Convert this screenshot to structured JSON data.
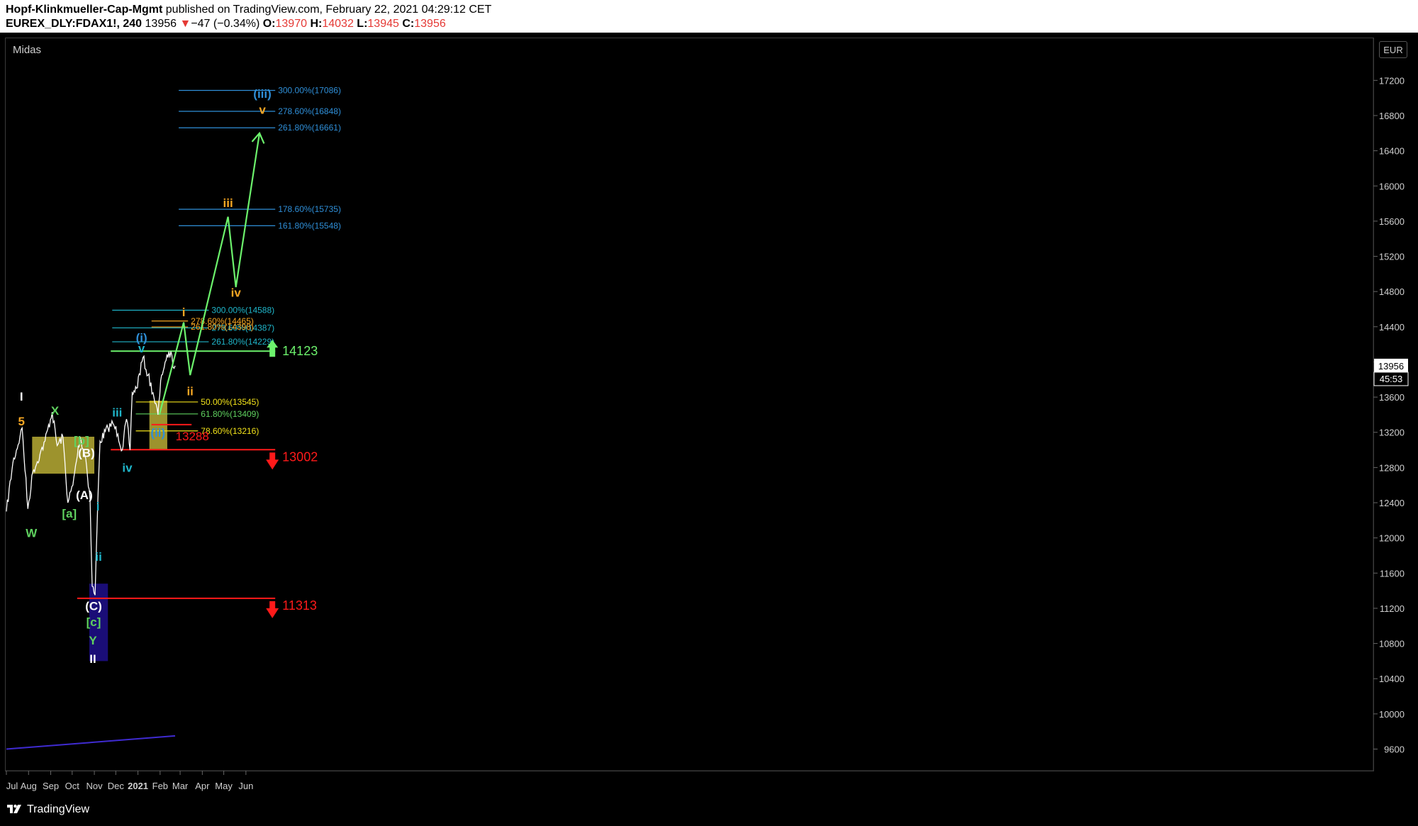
{
  "header": {
    "publisher": "Hopf-Klinkmueller-Cap-Mgmt",
    "published_text": "published on TradingView.com, February 22, 2021 04:29:12 CET",
    "symbol": "EUREX_DLY:FDAX1!, 240",
    "last": "13956",
    "change": "−47 (−0.34%)",
    "open_label": "O:",
    "open": "13970",
    "high_label": "H:",
    "high": "14032",
    "low_label": "L:",
    "low": "13945",
    "close_label": "C:",
    "close": "13956"
  },
  "study_name": "Midas",
  "currency": "EUR",
  "footer": {
    "brand": "TradingView"
  },
  "colors": {
    "background": "#000000",
    "price": "#ffffff",
    "projection": "#6cf26c",
    "support": "#ff1a1a",
    "fib_blue": "#2f8fd8",
    "fib_cyan": "#1fb5c9",
    "fib_orange": "#f5a623",
    "fib_yellow": "#f2e21a",
    "fib_green": "#5fd15f",
    "zone_yellow": "#c9bd3a",
    "zone_blue": "#1e0f8c",
    "midas_line": "#3f2bd1"
  },
  "chart_data": {
    "type": "line",
    "title": "",
    "xlabel": "",
    "ylabel": "",
    "x_ticks": [
      "Jul",
      "Aug",
      "Sep",
      "Oct",
      "Nov",
      "Dec",
      "2021",
      "Feb",
      "Mar",
      "Apr",
      "May",
      "Jun"
    ],
    "y_ticks": [
      9600,
      10000,
      10400,
      10800,
      11200,
      11600,
      12000,
      12400,
      12800,
      13200,
      13600,
      14000,
      14400,
      14800,
      15200,
      15600,
      16000,
      16400,
      16800,
      17200
    ],
    "ylim": [
      9340,
      17540
    ],
    "last_price_tag": "13956",
    "countdown_tag": "45:53",
    "price_series": {
      "name": "FDAX1!",
      "x": [
        "2020-07-01",
        "2020-07-10",
        "2020-07-20",
        "2020-07-23",
        "2020-07-31",
        "2020-08-07",
        "2020-08-17",
        "2020-08-24",
        "2020-09-03",
        "2020-09-10",
        "2020-09-18",
        "2020-09-25",
        "2020-10-02",
        "2020-10-12",
        "2020-10-20",
        "2020-10-26",
        "2020-10-29",
        "2020-11-02",
        "2020-11-06",
        "2020-11-09",
        "2020-11-20",
        "2020-11-27",
        "2020-12-04",
        "2020-12-10",
        "2020-12-16",
        "2020-12-21",
        "2020-12-24",
        "2020-12-30",
        "2021-01-08",
        "2021-01-15",
        "2021-01-22",
        "2021-01-29",
        "2021-02-03",
        "2021-02-08",
        "2021-02-12",
        "2021-02-16",
        "2021-02-19",
        "2021-02-22"
      ],
      "values": [
        12300,
        12850,
        13150,
        13250,
        12330,
        12750,
        12950,
        13100,
        13430,
        13050,
        13150,
        12400,
        12600,
        13150,
        12900,
        12450,
        11450,
        11350,
        12450,
        13100,
        13250,
        13300,
        13180,
        13000,
        13350,
        13000,
        13650,
        13700,
        14050,
        13850,
        13650,
        13400,
        13850,
        14000,
        14050,
        14120,
        13940,
        13956
      ]
    },
    "midas_line": {
      "x": [
        "2020-07-01",
        "2021-02-22"
      ],
      "values": [
        9600,
        9750
      ]
    },
    "projection_path": {
      "name": "",
      "x": [
        "2021-01-31",
        "2021-03-06",
        "2021-03-15",
        "2021-05-07",
        "2021-05-18",
        "2021-06-20"
      ],
      "values": [
        13400,
        14450,
        13850,
        15650,
        14850,
        16600
      ]
    },
    "horizontal_lines": [
      {
        "label": "300.00%(17086)",
        "value": 17086,
        "color": "#2f8fd8",
        "from": "2021-02-27",
        "to": "2021-07-12"
      },
      {
        "label": "278.60%(16848)",
        "value": 16848,
        "color": "#2f8fd8",
        "from": "2021-02-27",
        "to": "2021-07-12"
      },
      {
        "label": "261.80%(16661)",
        "value": 16661,
        "color": "#2f8fd8",
        "from": "2021-02-27",
        "to": "2021-07-12"
      },
      {
        "label": "178.60%(15735)",
        "value": 15735,
        "color": "#2f8fd8",
        "from": "2021-02-27",
        "to": "2021-07-12"
      },
      {
        "label": "161.80%(15548)",
        "value": 15548,
        "color": "#2f8fd8",
        "from": "2021-02-27",
        "to": "2021-07-12"
      },
      {
        "label": "300.00%(14588)",
        "value": 14588,
        "color": "#1fb5c9",
        "from": "2020-11-26",
        "to": "2021-04-10"
      },
      {
        "label": "278.60%(14387)",
        "value": 14387,
        "color": "#1fb5c9",
        "from": "2020-11-26",
        "to": "2021-04-10"
      },
      {
        "label": "261.80%(14229)",
        "value": 14229,
        "color": "#1fb5c9",
        "from": "2020-11-26",
        "to": "2021-04-10"
      },
      {
        "label": "278.60%(14465)",
        "value": 14465,
        "color": "#f5a623",
        "from": "2021-01-20",
        "to": "2021-03-12"
      },
      {
        "label": "261.80%(14398)",
        "value": 14398,
        "color": "#f5a623",
        "from": "2021-01-20",
        "to": "2021-03-12"
      },
      {
        "label": "",
        "value": 14123,
        "color": "#6cf26c",
        "from": "2020-11-24",
        "to": "2021-07-12"
      },
      {
        "label": "50.00%(13545)",
        "value": 13545,
        "color": "#f2e21a",
        "from": "2020-12-29",
        "to": "2021-03-26"
      },
      {
        "label": "61.80%(13409)",
        "value": 13409,
        "color": "#5fd15f",
        "from": "2020-12-29",
        "to": "2021-03-26"
      },
      {
        "label": "78.60%(13216)",
        "value": 13216,
        "color": "#f2e21a",
        "from": "2020-12-29",
        "to": "2021-03-26"
      },
      {
        "label": "",
        "value": 13288,
        "color": "#ff1a1a",
        "from": "2021-01-20",
        "to": "2021-03-17"
      },
      {
        "label": "",
        "value": 13002,
        "color": "#ff1a1a",
        "from": "2020-11-24",
        "to": "2021-07-12"
      },
      {
        "label": "",
        "value": 11313,
        "color": "#ff1a1a",
        "from": "2020-10-08",
        "to": "2021-07-12"
      }
    ],
    "zones": [
      {
        "x0": "2020-08-06",
        "x1": "2020-11-01",
        "y0": 12730,
        "y1": 13150,
        "color": "#c9bd3a"
      },
      {
        "x0": "2020-10-25",
        "x1": "2020-11-20",
        "y0": 10600,
        "y1": 11480,
        "color": "#1e0f8c"
      },
      {
        "x0": "2021-01-17",
        "x1": "2021-02-11",
        "y0": 13005,
        "y1": 13560,
        "color": "#c9bd3a"
      }
    ],
    "level_labels": [
      {
        "text": "14123",
        "value": 14123,
        "x": "2021-07-08",
        "color": "#6cf26c",
        "arrow": "up"
      },
      {
        "text": "13002",
        "value": 13002,
        "x": "2021-07-08",
        "color": "#ff1a1a",
        "arrow": "down"
      },
      {
        "text": "11313",
        "value": 11313,
        "x": "2021-07-08",
        "color": "#ff1a1a",
        "arrow": "down"
      },
      {
        "text": "13288",
        "value": 13288,
        "x": "2021-03-18",
        "color": "#ff1a1a",
        "arrow": ""
      }
    ],
    "annotations": [
      {
        "text": "I",
        "x": "2020-07-22",
        "y": 13560,
        "color": "#ffffff"
      },
      {
        "text": "5",
        "x": "2020-07-22",
        "y": 13280,
        "color": "#f5a623"
      },
      {
        "text": "W",
        "x": "2020-08-05",
        "y": 12010,
        "color": "#5fd15f"
      },
      {
        "text": "X",
        "x": "2020-09-07",
        "y": 13400,
        "color": "#5fd15f"
      },
      {
        "text": "[b]",
        "x": "2020-10-14",
        "y": 13060,
        "color": "#5fd15f"
      },
      {
        "text": "(B)",
        "x": "2020-10-21",
        "y": 12920,
        "color": "#ffffff"
      },
      {
        "text": "[a]",
        "x": "2020-09-27",
        "y": 12230,
        "color": "#5fd15f"
      },
      {
        "text": "(A)",
        "x": "2020-10-18",
        "y": 12440,
        "color": "#ffffff"
      },
      {
        "text": "i",
        "x": "2020-11-06",
        "y": 12310,
        "color": "#1fb5c9"
      },
      {
        "text": "ii",
        "x": "2020-11-07",
        "y": 11740,
        "color": "#1fb5c9"
      },
      {
        "text": "(C)",
        "x": "2020-10-31",
        "y": 11180,
        "color": "#ffffff"
      },
      {
        "text": "[c]",
        "x": "2020-10-31",
        "y": 11000,
        "color": "#5fd15f"
      },
      {
        "text": "Y",
        "x": "2020-10-30",
        "y": 10790,
        "color": "#5fd15f"
      },
      {
        "text": "II",
        "x": "2020-10-30",
        "y": 10580,
        "color": "#ffffff"
      },
      {
        "text": "iii",
        "x": "2020-12-03",
        "y": 13380,
        "color": "#1fb5c9"
      },
      {
        "text": "iv",
        "x": "2020-12-17",
        "y": 12750,
        "color": "#1fb5c9"
      },
      {
        "text": "(i)",
        "x": "2021-01-06",
        "y": 14230,
        "color": "#2f8fd8"
      },
      {
        "text": "v",
        "x": "2021-01-06",
        "y": 14110,
        "color": "#1fb5c9"
      },
      {
        "text": "(ii)",
        "x": "2021-01-29",
        "y": 13150,
        "color": "#2f8fd8"
      },
      {
        "text": "i",
        "x": "2021-03-06",
        "y": 14520,
        "color": "#f5a623"
      },
      {
        "text": "ii",
        "x": "2021-03-15",
        "y": 13620,
        "color": "#f5a623"
      },
      {
        "text": "iii",
        "x": "2021-05-07",
        "y": 15760,
        "color": "#f5a623"
      },
      {
        "text": "iv",
        "x": "2021-05-18",
        "y": 14740,
        "color": "#f5a623"
      },
      {
        "text": "(iii)",
        "x": "2021-06-24",
        "y": 17000,
        "color": "#2f8fd8"
      },
      {
        "text": "v",
        "x": "2021-06-24",
        "y": 16820,
        "color": "#f5a623"
      }
    ]
  }
}
